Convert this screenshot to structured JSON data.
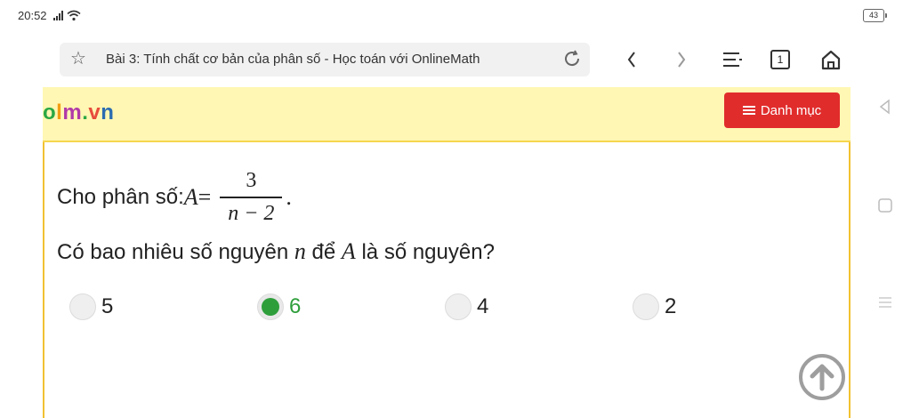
{
  "status": {
    "time": "20:52",
    "battery": "43"
  },
  "browser": {
    "page_title": "Bài 3: Tính chất cơ bản của phân số - Học toán với OnlineMath",
    "tab_count": "1"
  },
  "site": {
    "logo": {
      "o": "o",
      "l": "l",
      "m": "m",
      "dot": ".",
      "v": "v",
      "n": "n"
    },
    "menu_label": "Danh mục"
  },
  "question": {
    "intro": "Cho phân số: ",
    "var_A": "A",
    "equals": " = ",
    "frac_num": "3",
    "frac_den": "n − 2",
    "period": ".",
    "line2_a": "Có bao nhiêu số nguyên ",
    "var_n": "n",
    "line2_b": " để ",
    "var_A2": "A",
    "line2_c": " là số nguyên?"
  },
  "options": [
    {
      "label": "5",
      "selected": false
    },
    {
      "label": "6",
      "selected": true
    },
    {
      "label": "4",
      "selected": false
    },
    {
      "label": "2",
      "selected": false
    }
  ],
  "colors": {
    "accent_green": "#2e9e3b",
    "menu_red": "#e12c2c",
    "header_yellow": "#fff7b3"
  }
}
